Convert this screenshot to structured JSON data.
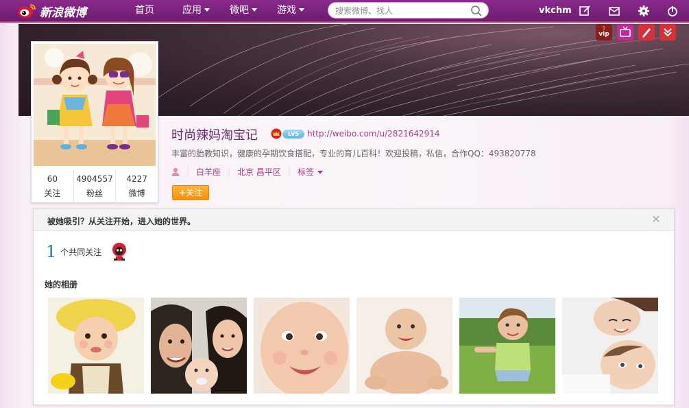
{
  "topbar": {
    "logo_text": "新浪微博",
    "nav": [
      {
        "label": "首页",
        "has_menu": false
      },
      {
        "label": "应用",
        "has_menu": true
      },
      {
        "label": "微吧",
        "has_menu": true
      },
      {
        "label": "游戏",
        "has_menu": true
      }
    ],
    "search_placeholder": "搜索微博、找人",
    "username": "vkchm",
    "icons": [
      "compose-icon",
      "mail-icon",
      "gear-icon",
      "power-icon"
    ]
  },
  "banner": {
    "badges": [
      "vip-badge",
      "tv-badge",
      "write-badge",
      "download-badge"
    ]
  },
  "profile": {
    "name": "时尚辣妈淘宝记",
    "level": "LV5",
    "url": "http://weibo.com/u/2821642914",
    "description": "丰富的胎教知识，健康的孕期饮食搭配，专业的育儿百科！欢迎投稿，私信，合作QQ：493820778",
    "zodiac": "白羊座",
    "location": "北京 昌平区",
    "tags_label": "标签",
    "follow_label": "关注",
    "stats": [
      {
        "num": "60",
        "label": "关注"
      },
      {
        "num": "4904557",
        "label": "粉丝"
      },
      {
        "num": "4227",
        "label": "微博"
      }
    ]
  },
  "panel": {
    "title": "被她吸引？从关注开始，进入她的世界。",
    "common_count": "1",
    "common_text": "个共同关注",
    "album_title": "她的相册"
  },
  "colors": {
    "topbar": "#7a2380",
    "accent": "#a23a80",
    "follow_orange": "#f59303",
    "common_blue": "#1a7fc1"
  }
}
